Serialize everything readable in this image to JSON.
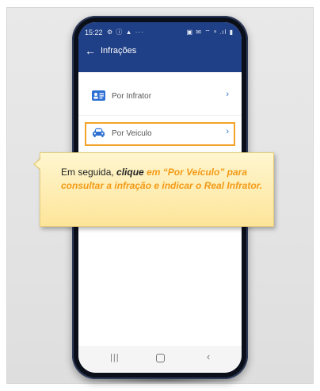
{
  "status_bar": {
    "time": "15:22",
    "left_icons": "⚙ ⓘ ▲ ···",
    "right_icons": "▣ ✉ ⌔ ᵃ .ıl ▮"
  },
  "app_bar": {
    "back_icon": "arrow-left-icon",
    "title": "Infrações"
  },
  "menu": [
    {
      "label": "Por Infrator",
      "icon": "id-card-icon",
      "highlighted": false
    },
    {
      "label": "Por Veiculo",
      "icon": "car-icon",
      "highlighted": true
    }
  ],
  "chevron": "›",
  "nav_bar": {
    "recent": "|||",
    "back": "‹"
  },
  "callout": {
    "part1": "Em seguida, ",
    "part2": "clique",
    "part3": " em “Por Veículo” para consultar a infração e indicar o Real Infrator."
  },
  "colors": {
    "app_bar": "#1f3f86",
    "highlight": "#f3a32a",
    "accent": "#2d6fd3",
    "callout_text_highlight": "#f39a16"
  }
}
